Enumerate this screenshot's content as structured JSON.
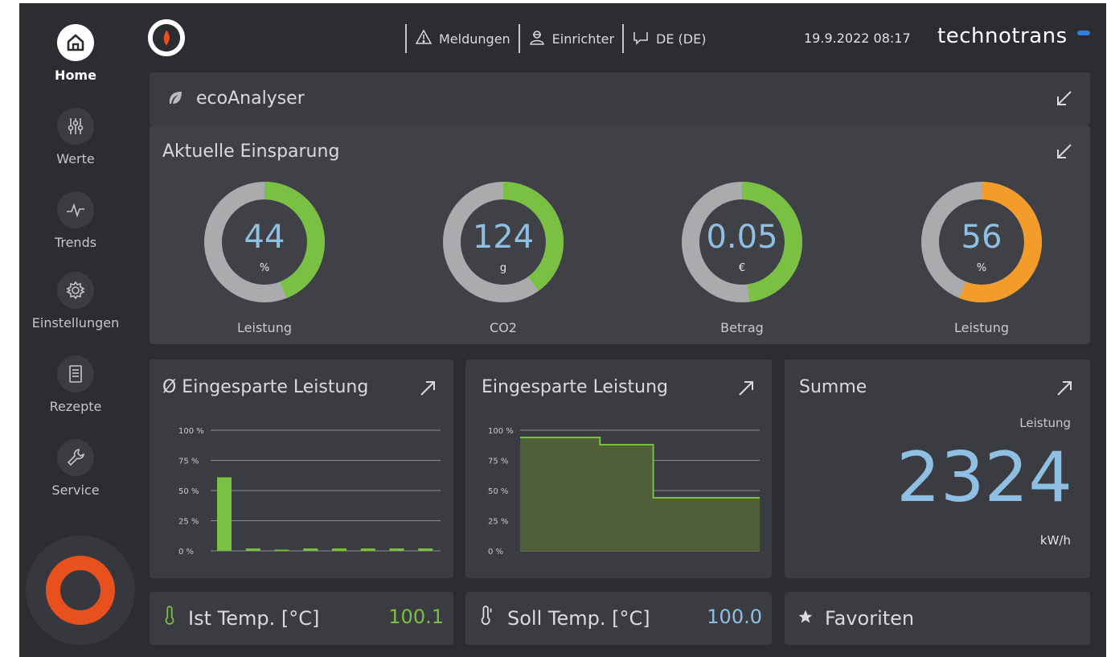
{
  "sidebar": {
    "items": [
      {
        "label": "Home",
        "icon": "home-icon",
        "active": true
      },
      {
        "label": "Werte",
        "icon": "sliders-icon"
      },
      {
        "label": "Trends",
        "icon": "trend-icon"
      },
      {
        "label": "Einstellungen",
        "icon": "gear-icon"
      },
      {
        "label": "Rezepte",
        "icon": "document-icon"
      },
      {
        "label": "Service",
        "icon": "wrench-icon"
      }
    ],
    "start_button_color": "#e8501e"
  },
  "header": {
    "meldungen": "Meldungen",
    "einrichter": "Einrichter",
    "language": "DE (DE)",
    "datetime": "19.9.2022 08:17",
    "brand": "technotrans"
  },
  "eco": {
    "title": "ecoAnalyser",
    "section_title": "Aktuelle Einsparung",
    "gauges": [
      {
        "value": "44",
        "unit": "%",
        "label": "Leistung",
        "fraction": 0.44,
        "color": "#7ac143"
      },
      {
        "value": "124",
        "unit": "g",
        "label": "CO2",
        "fraction": 0.4,
        "color": "#7ac143"
      },
      {
        "value": "0.05",
        "unit": "€",
        "label": "Betrag",
        "fraction": 0.48,
        "color": "#7ac143"
      },
      {
        "value": "56",
        "unit": "%",
        "label": "Leistung",
        "fraction": 0.56,
        "color": "#f39c2a"
      }
    ]
  },
  "avg_panel": {
    "title": "Ø Eingesparte Leistung"
  },
  "trend_panel": {
    "title": "Eingesparte Leistung"
  },
  "sum_panel": {
    "title": "Summe",
    "caption": "Leistung",
    "value": "2324",
    "unit": "kW/h"
  },
  "ist_temp": {
    "label": "Ist Temp. [°C]",
    "value": "100.1",
    "color": "#7ac143"
  },
  "soll_temp": {
    "label": "Soll Temp. [°C]",
    "value": "100.0",
    "color": "#8fc0e3"
  },
  "favorites": {
    "label": "Favoriten"
  },
  "chart_data": [
    {
      "type": "bar",
      "yticks": [
        "100 %",
        "75 %",
        "50 %",
        "25 %",
        "0 %"
      ],
      "ylim": [
        0,
        100
      ],
      "values": [
        61,
        2,
        1,
        2,
        2,
        2,
        2,
        2
      ],
      "color": "#7ac143",
      "grid": true
    },
    {
      "type": "area",
      "yticks": [
        "100 %",
        "75 %",
        "50 %",
        "25 %",
        "0 %"
      ],
      "ylim": [
        0,
        100
      ],
      "values": [
        94,
        94,
        94,
        88,
        88,
        44,
        44,
        44,
        44,
        44
      ],
      "color": "#7ac143",
      "grid": true
    }
  ]
}
